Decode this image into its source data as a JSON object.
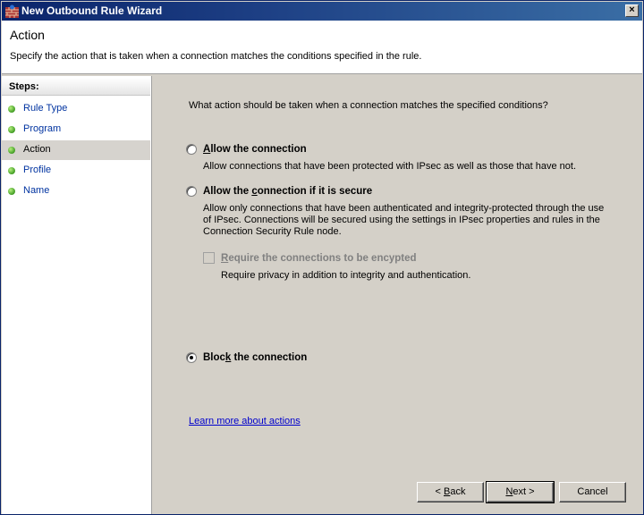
{
  "window": {
    "title": "New Outbound Rule Wizard",
    "close_glyph": "×"
  },
  "header": {
    "title": "Action",
    "description": "Specify the action that is taken when a connection matches the conditions specified in the rule."
  },
  "steps": {
    "heading": "Steps:",
    "items": [
      {
        "label": "Rule Type"
      },
      {
        "label": "Program"
      },
      {
        "label": "Action"
      },
      {
        "label": "Profile"
      },
      {
        "label": "Name"
      }
    ],
    "current_index": 2,
    "bullet_color": "#4fa82f"
  },
  "main": {
    "prompt": "What action should be taken when a connection matches the specified conditions?",
    "options": {
      "allow": {
        "label_pre": "",
        "label_u": "A",
        "label_post": "llow the connection",
        "description": "Allow connections that have been protected with IPsec as well as those that have not.",
        "checked": false
      },
      "allow_secure": {
        "label_pre": "Allow the ",
        "label_u": "c",
        "label_post": "onnection if it is secure",
        "description": "Allow only connections that have been authenticated and integrity-protected through the use of IPsec.  Connections will be secured using the settings in IPsec properties and rules in the Connection Security Rule node.",
        "checked": false
      },
      "require_encrypted": {
        "label_pre": "",
        "label_u": "R",
        "label_post": "equire the connections to be encypted",
        "description": "Require privacy in addition to integrity and authentication.",
        "checked": false,
        "enabled": false
      },
      "block": {
        "label_pre": "Bloc",
        "label_u": "k",
        "label_post": " the connection",
        "checked": true
      }
    },
    "learn_more": "Learn more about actions"
  },
  "buttons": {
    "back": {
      "pre": "< ",
      "u": "B",
      "post": "ack"
    },
    "next": {
      "pre": "",
      "u": "N",
      "post": "ext >"
    },
    "cancel": "Cancel"
  },
  "colors": {
    "titlebar": "#0a246a",
    "link": "#0000cc",
    "step_link": "#0033a0"
  }
}
